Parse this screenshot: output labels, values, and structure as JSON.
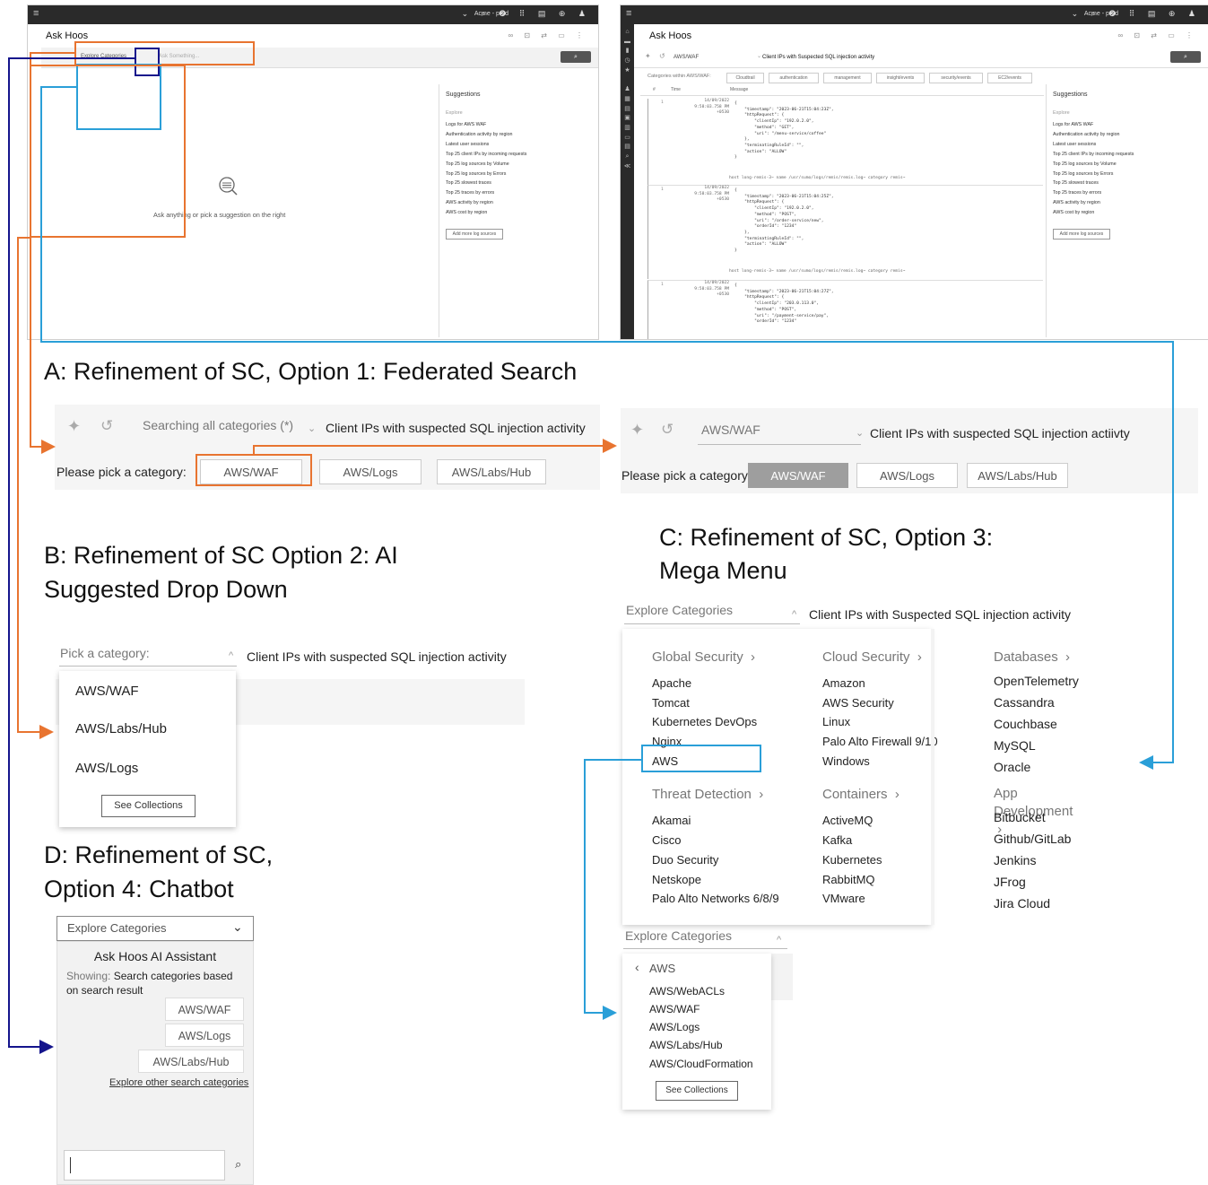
{
  "colors": {
    "orange": "#e87430",
    "blue": "#2a9fd8",
    "navy": "#14148c",
    "dark_rail": "#2a2a2a"
  },
  "shot_left": {
    "app_title": "Ask Hoos",
    "account": "Acme - prod",
    "explore_label": "Explore Categories",
    "search_placeholder": "Ask Something...",
    "empty_text": "Ask anything or pick a suggestion on the right",
    "suggestions_title": "Suggestions",
    "suggestions_subtitle": "Explore",
    "suggestions": [
      "Logs for AWS WAF",
      "Authentication activity by region",
      "Latest user sessions",
      "Top 25 client IPs by incoming requests",
      "Top 25 log sources by Volume",
      "Top 25 log sources by Errors",
      "Top 25 slowest traces",
      "Top 25 traces by errors",
      "AWS activity by region",
      "AWS cost by region"
    ],
    "add_sources": "Add more log sources"
  },
  "shot_right": {
    "app_title": "Ask Hoos",
    "account": "Acme - prod",
    "selected_category": "AWS/WAF",
    "query": "Client IPs with Suspected SQL injection activity",
    "categories_label": "Categories within AWS/WAF:",
    "category_chips": [
      "Cloudtrail",
      "authentication",
      "management",
      "insight/events",
      "security/events",
      "EC2/events"
    ],
    "col_num": "#",
    "col_time": "Time",
    "col_message": "Message",
    "logs": [
      {
        "num": "1",
        "date": "14/09/2022",
        "time": "9:58:03.758 PM",
        "tz": "+0530",
        "message": "{\n    \"timestamp\": \"2023-06-21T15:04:23Z\",\n    \"httpRequest\": {\n        \"clientIp\": \"192.0.2.0\",\n        \"method\": \"GET\",\n        \"uri\": \"/menu-service/coffee\"\n    },\n    \"terminatingRuleId\": \"\",\n    \"action\": \"ALLOW\"\n}",
        "meta": "host long-remis-3~   name /usr/sumo/logs/remis/remis.log~   category remis~"
      },
      {
        "num": "1",
        "date": "14/09/2022",
        "time": "9:58:03.758 PM",
        "tz": "+0530",
        "message": "{\n    \"timestamp\": \"2023-06-21T15:04:25Z\",\n    \"httpRequest\": {\n        \"clientIp\": \"192.0.2.0\",\n        \"method\": \"POST\",\n        \"uri\": \"/order-service/new\",\n        \"orderId\": \"1234\"\n    },\n    \"terminatingRuleId\": \"\",\n    \"action\": \"ALLOW\"\n}",
        "meta": "host long-remis-3~   name /usr/sumo/logs/remis/remis.log~   category remis~"
      },
      {
        "num": "1",
        "date": "14/09/2022",
        "time": "9:58:03.758 PM",
        "tz": "+0530",
        "message": "{\n    \"timestamp\": \"2023-06-21T15:04:27Z\",\n    \"httpRequest\": {\n        \"clientIp\": \"203.0.113.0\",\n        \"method\": \"POST\",\n        \"uri\": \"/payment-service/pay\",\n        \"orderId\": \"1234\"",
        "meta": ""
      }
    ],
    "suggestions_title": "Suggestions",
    "suggestions_subtitle": "Explore",
    "suggestions": [
      "Logs for AWS WAF",
      "Authentication activity by region",
      "Latest user sessions",
      "Top 25 client IPs by incoming requests",
      "Top 25 log sources by Volume",
      "Top 25 log sources by Errors",
      "Top 25 slowest traces",
      "Top 25 traces by errors",
      "AWS activity by region",
      "AWS cost by region"
    ],
    "add_sources": "Add more log sources"
  },
  "option_a": {
    "heading": "A: Refinement of SC, Option 1: Federated Search",
    "left": {
      "selector": "Searching all categories (*)",
      "query": "Client IPs with suspected SQL injection activity",
      "pick_label": "Please pick a category:",
      "chips": [
        "AWS/WAF",
        "AWS/Logs",
        "AWS/Labs/Hub"
      ]
    },
    "right": {
      "selector": "AWS/WAF",
      "query": "Client IPs with suspected SQL injection actiivty",
      "pick_label": "Please pick a category:",
      "chips": [
        "AWS/WAF",
        "AWS/Logs",
        "AWS/Labs/Hub"
      ]
    }
  },
  "option_b": {
    "heading_line1": "B: Refinement of SC Option 2: AI",
    "heading_line2": "Suggested Drop Down",
    "selector_placeholder": "Pick a category:",
    "query": "Client IPs with suspected SQL injection activity",
    "items": [
      "AWS/WAF",
      "AWS/Labs/Hub",
      "AWS/Logs"
    ],
    "see_collections": "See Collections"
  },
  "option_c": {
    "heading_line1": "C: Refinement of SC, Option 3:",
    "heading_line2": "Mega Menu",
    "selector": "Explore Categories",
    "query": "Client IPs with Suspected SQL injection activity",
    "columns": [
      {
        "groups": [
          {
            "title": "Global Security",
            "items": [
              "Apache",
              "Tomcat",
              "Kubernetes DevOps",
              "Nginx",
              "AWS"
            ]
          },
          {
            "title": "Threat Detection",
            "items": [
              "Akamai",
              "Cisco",
              "Duo Security",
              "Netskope",
              "Palo Alto Networks 6/8/9"
            ]
          }
        ]
      },
      {
        "groups": [
          {
            "title": "Cloud Security",
            "items": [
              "Amazon",
              "AWS Security",
              "Linux",
              "Palo Alto Firewall 9/10",
              "Windows"
            ]
          },
          {
            "title": "Containers",
            "items": [
              "ActiveMQ",
              "Kafka",
              "Kubernetes",
              "RabbitMQ",
              "VMware"
            ]
          }
        ]
      },
      {
        "groups": [
          {
            "title": "Databases",
            "items": [
              "OpenTelemetry",
              "Cassandra",
              "Couchbase",
              "MySQL",
              "Oracle"
            ]
          },
          {
            "title": "App Development",
            "items": [
              "Bitbucket",
              "Github/GitLab",
              "Jenkins",
              "JFrog",
              "Jira Cloud"
            ]
          }
        ]
      }
    ],
    "sub_selector": "Explore Categories",
    "sub_back": "AWS",
    "sub_items": [
      "AWS/WebACLs",
      "AWS/WAF",
      "AWS/Logs",
      "AWS/Labs/Hub",
      "AWS/CloudFormation"
    ],
    "see_collections": "See Collections"
  },
  "option_d": {
    "heading_line1": "D: Refinement of SC,",
    "heading_line2": "Option 4: Chatbot",
    "selector": "Explore Categories",
    "assistant_title": "Ask Hoos AI Assistant",
    "showing_label": "Showing:",
    "showing_text": "Search categories based on search result",
    "pills": [
      "AWS/WAF",
      "AWS/Logs",
      "AWS/Labs/Hub"
    ],
    "explore_link": "Explore other search categories"
  }
}
